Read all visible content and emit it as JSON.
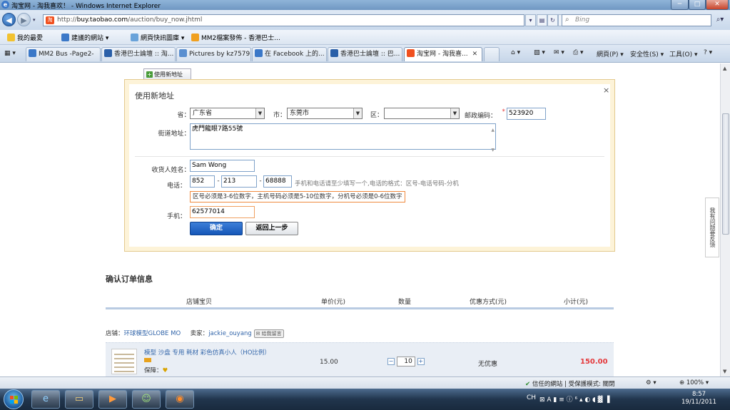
{
  "window": {
    "title": "淘宝网 - 淘我喜欢！ - Windows Internet Explorer",
    "controls": [
      "─",
      "□",
      "✕"
    ]
  },
  "address_bar": {
    "url_prefix": "http://",
    "url_domain": "buy.taobao.com",
    "url_path": "/auction/buy_now.jhtml",
    "search_placeholder": "Bing"
  },
  "favorites_bar": {
    "items": [
      "我的最愛",
      "建議的網站 ▾",
      "網頁快訊圖庫 ▾",
      "MM2檔案發佈 - 香港巴士..."
    ]
  },
  "tabs": [
    {
      "label": "MM2 Bus -Page2-"
    },
    {
      "label": "香港巴士論壇 :: 淘..."
    },
    {
      "label": "Pictures by kz7579..."
    },
    {
      "label": "在 Facebook 上的..."
    },
    {
      "label": "香港巴士論壇 :: 巴..."
    },
    {
      "label": "淘宝网 - 淘我喜..."
    }
  ],
  "command_bar": {
    "page": "網頁(P) ▾",
    "safety": "安全性(S) ▾",
    "tools": "工具(O) ▾"
  },
  "page": {
    "new_address_button": "使用新地址",
    "feedback_tab": "我有问题要反馈"
  },
  "dialog": {
    "title": "使用新地址",
    "close": "×",
    "province_label": "省：",
    "province_value": "广东省",
    "city_label": "市：",
    "city_value": "东莞市",
    "district_label": "区：",
    "district_value": "",
    "postcode_label": "邮政编码：",
    "postcode_value": "523920",
    "street_label": "街道地址：",
    "street_value": "虎門龍眼7路55號",
    "name_label": "收货人姓名：",
    "name_value": "Sam Wong",
    "phone_label": "电话：",
    "phone_area": "852",
    "phone_main": "213",
    "phone_ext": "68888",
    "phone_sep": "-",
    "phone_hint": "手机和电话请至少填写一个,电话的格式：区号-电话号码-分机",
    "phone_error": "区号必须是3-6位数字，主机号码必须是5-10位数字，分机号必须是0-6位数字",
    "mobile_label": "手机：",
    "mobile_value": "62577014",
    "confirm_button": "确定",
    "back_button": "返回上一步",
    "required_mark": "*"
  },
  "order": {
    "section_title": "确认订单信息",
    "columns": [
      "店铺宝贝",
      "单价(元)",
      "数量",
      "优惠方式(元)",
      "小计(元)"
    ],
    "shop_label": "店铺：",
    "shop_name": "环球模型GLOBE MO",
    "seller_label": "卖家：",
    "seller_name": "jackie_ouyang",
    "message_button": "给我留言",
    "item": {
      "name": "模型 沙盘 专用 耗材 彩色仿真小人（HO比例）",
      "protection_label": "保障：",
      "price": "15.00",
      "quantity": "10",
      "discount": "无优惠",
      "subtotal": "150.00"
    }
  },
  "status_bar": {
    "zone": "信任的網站 | 受保護模式: 關閉",
    "zoom": "100%"
  },
  "taskbar": {
    "ime": "CH",
    "time": "8:57",
    "date": "19/11/2011"
  }
}
